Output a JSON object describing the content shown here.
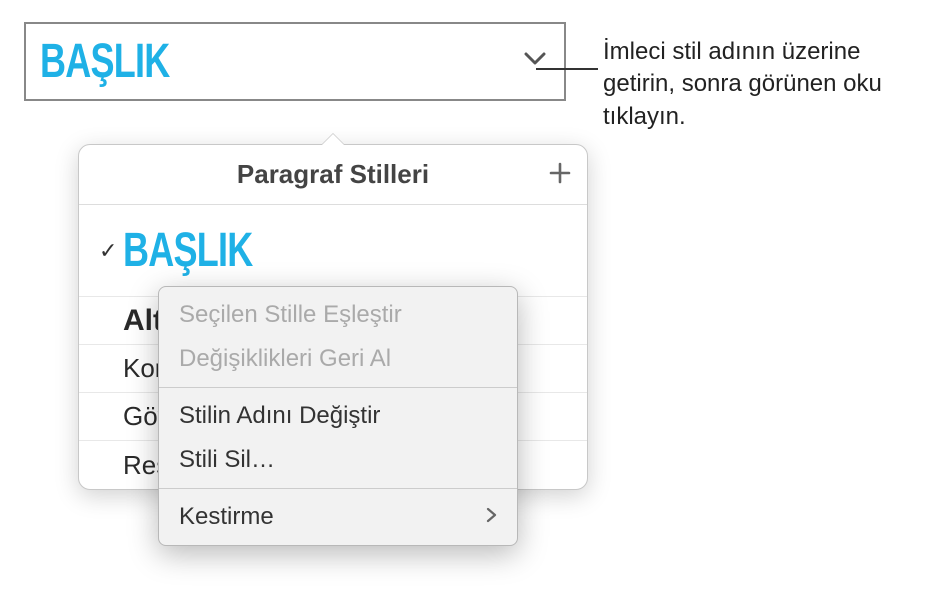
{
  "selector": {
    "current_style": "BAŞLIK"
  },
  "popover": {
    "title": "Paragraf Stilleri",
    "items": [
      {
        "label": "BAŞLIK",
        "checked": true
      },
      {
        "label": "Alt"
      },
      {
        "label": "Kon"
      },
      {
        "label": "Göv"
      },
      {
        "label": "Resim Yazısı"
      }
    ]
  },
  "context_menu": {
    "match": "Seçilen Stille Eşleştir",
    "revert": "Değişiklikleri Geri Al",
    "rename": "Stilin Adını Değiştir",
    "delete": "Stili Sil…",
    "shortcut": "Kestirme"
  },
  "callout": "İmleci stil adının üzerine getirin, sonra görünen oku tıklayın."
}
